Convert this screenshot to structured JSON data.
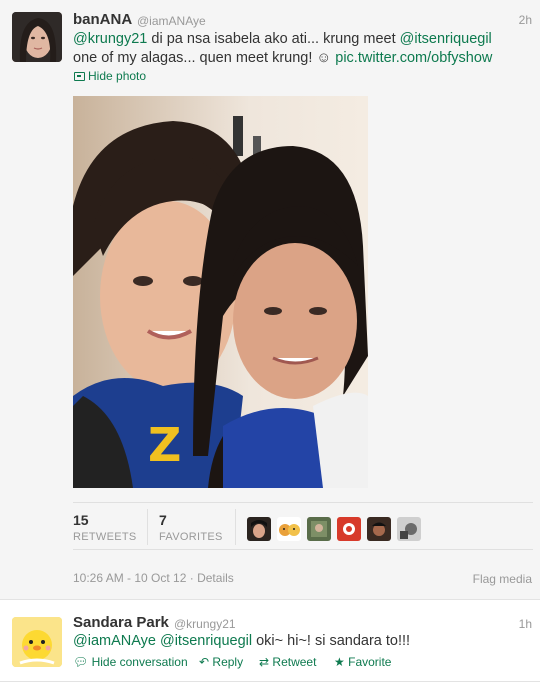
{
  "tweet1": {
    "name": "banANA",
    "handle": "@iamANAye",
    "time": "2h",
    "mention1": "@krungy21",
    "text_part1": " di pa nsa isabela ako ati... krung meet ",
    "mention2": "@itsenriquegil",
    "line2": "one of my alagas... quen meet krung! ☺ ",
    "pic_link": "pic.twitter.com/obfyshow",
    "hide_photo": "Hide photo",
    "retweets_count": "15",
    "retweets_label": "RETWEETS",
    "favorites_count": "7",
    "favorites_label": "FAVORITES",
    "timestamp": "10:26 AM - 10 Oct 12",
    "details": "Details",
    "flag_media": "Flag media"
  },
  "tweet2": {
    "name": "Sandara Park",
    "handle": "@krungy21",
    "time": "1h",
    "mention1": "@iamANAye",
    "mention2": "@itsenriquegil",
    "text": " oki~ hi~! si sandara to!!!",
    "hide_conversation": "Hide conversation",
    "reply": "Reply",
    "retweet": "Retweet",
    "favorite": "Favorite"
  },
  "colors": {
    "link": "#0e7a4f",
    "muted": "#999999",
    "background": "#f5f5f5"
  },
  "icons": [
    "photo-icon",
    "speech-bubble-icon",
    "reply-arrow-icon",
    "retweet-icon",
    "star-icon"
  ]
}
